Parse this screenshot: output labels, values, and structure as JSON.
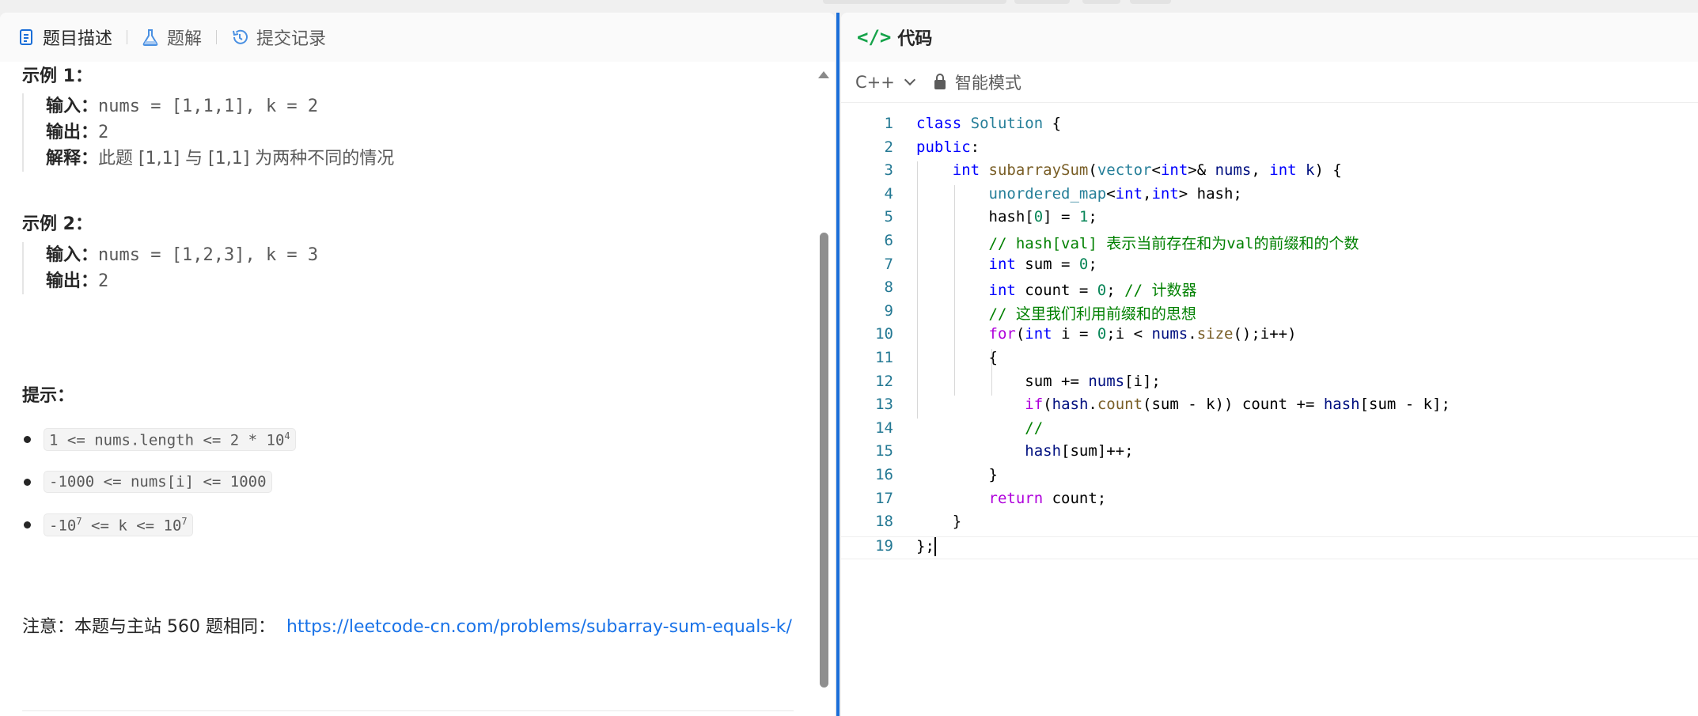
{
  "left_tabs": [
    {
      "label": "题目描述",
      "icon": "document-icon",
      "active": true
    },
    {
      "label": "题解",
      "icon": "flask-icon",
      "active": false
    },
    {
      "label": "提交记录",
      "icon": "history-icon",
      "active": false
    }
  ],
  "examples": [
    {
      "title": "示例 1：",
      "input_label": "输入：",
      "input_value": "nums = [1,1,1], k = 2",
      "output_label": "输出：",
      "output_value": "2",
      "explain_label": "解释：",
      "explain_value": "此题 [1,1] 与 [1,1] 为两种不同的情况"
    },
    {
      "title": "示例 2：",
      "input_label": "输入：",
      "input_value": "nums = [1,2,3], k = 3",
      "output_label": "输出：",
      "output_value": "2"
    }
  ],
  "tips": {
    "title": "提示：",
    "items": [
      {
        "text": "1 <= nums.length <= 2 * 10",
        "sup": "4",
        "after": ""
      },
      {
        "text": "-1000 <= nums[i] <= 1000",
        "sup": "",
        "after": ""
      },
      {
        "text": "-10",
        "sup": "7",
        "after": " <= k <= 10",
        "sup2": "7"
      }
    ]
  },
  "note": {
    "text": "注意：本题与主站 560 题相同：",
    "link": "https://leetcode-cn.com/problems/subarray-sum-equals-k/"
  },
  "code_panel": {
    "title": "代码",
    "code_icon": "</>",
    "language": "C++",
    "mode": "智能模式"
  },
  "colors": {
    "accent_blue": "#1a6ed8",
    "link": "#1a73e8",
    "code_icon_green": "#16a34a"
  },
  "code_lines": [
    "class Solution {",
    "public:",
    "    int subarraySum(vector<int>& nums, int k) {",
    "        unordered_map<int,int> hash;",
    "        hash[0] = 1;",
    "        // hash[val] 表示当前存在和为val的前缀和的个数",
    "        int sum = 0;",
    "        int count = 0; // 计数器",
    "        // 这里我们利用前缀和的思想",
    "        for(int i = 0;i < nums.size();i++)",
    "        {",
    "            sum += nums[i];",
    "            if(hash.count(sum - k)) count += hash[sum - k];",
    "            //",
    "            hash[sum]++;",
    "        }",
    "        return count;",
    "    }",
    "};"
  ],
  "line_numbers": [
    "1",
    "2",
    "3",
    "4",
    "5",
    "6",
    "7",
    "8",
    "9",
    "10",
    "11",
    "12",
    "13",
    "14",
    "15",
    "16",
    "17",
    "18",
    "19"
  ]
}
